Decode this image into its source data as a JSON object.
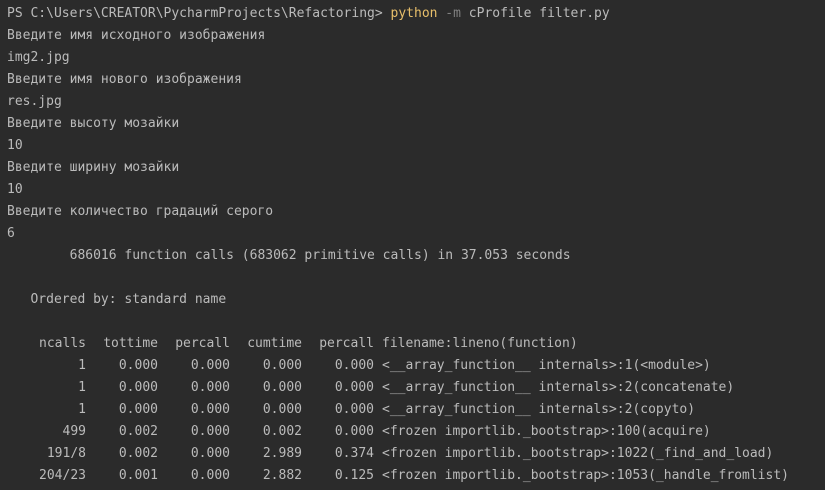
{
  "prompt": {
    "prefix": "PS C:\\Users\\CREATOR\\PycharmProjects\\Refactoring> ",
    "command": "python",
    "flag": " -m ",
    "args": "cProfile filter.py"
  },
  "dialog": [
    "Введите имя исходного изображения",
    "img2.jpg",
    "Введите имя нового изображения",
    "res.jpg",
    "Введите высоту мозайки",
    "10",
    "Введите ширину мозайки",
    "10",
    "Введите количество градаций серого",
    "6"
  ],
  "profile": {
    "summary": "        686016 function calls (683062 primitive calls) in 37.053 seconds",
    "ordered_by": "   Ordered by: standard name",
    "columns": [
      "ncalls",
      "tottime",
      "percall",
      "cumtime",
      "percall",
      "filename:lineno(function)"
    ],
    "rows": [
      [
        "1",
        "0.000",
        "0.000",
        "0.000",
        "0.000",
        "<__array_function__ internals>:1(<module>)"
      ],
      [
        "1",
        "0.000",
        "0.000",
        "0.000",
        "0.000",
        "<__array_function__ internals>:2(concatenate)"
      ],
      [
        "1",
        "0.000",
        "0.000",
        "0.000",
        "0.000",
        "<__array_function__ internals>:2(copyto)"
      ],
      [
        "499",
        "0.002",
        "0.000",
        "0.002",
        "0.000",
        "<frozen importlib._bootstrap>:100(acquire)"
      ],
      [
        "191/8",
        "0.002",
        "0.000",
        "2.989",
        "0.374",
        "<frozen importlib._bootstrap>:1022(_find_and_load)"
      ],
      [
        "204/23",
        "0.001",
        "0.000",
        "2.882",
        "0.125",
        "<frozen importlib._bootstrap>:1053(_handle_fromlist)"
      ]
    ]
  },
  "colors": {
    "background": "#2b2b2b",
    "text": "#bbbbbb",
    "command": "#e8bf6a",
    "flag": "#808080"
  }
}
